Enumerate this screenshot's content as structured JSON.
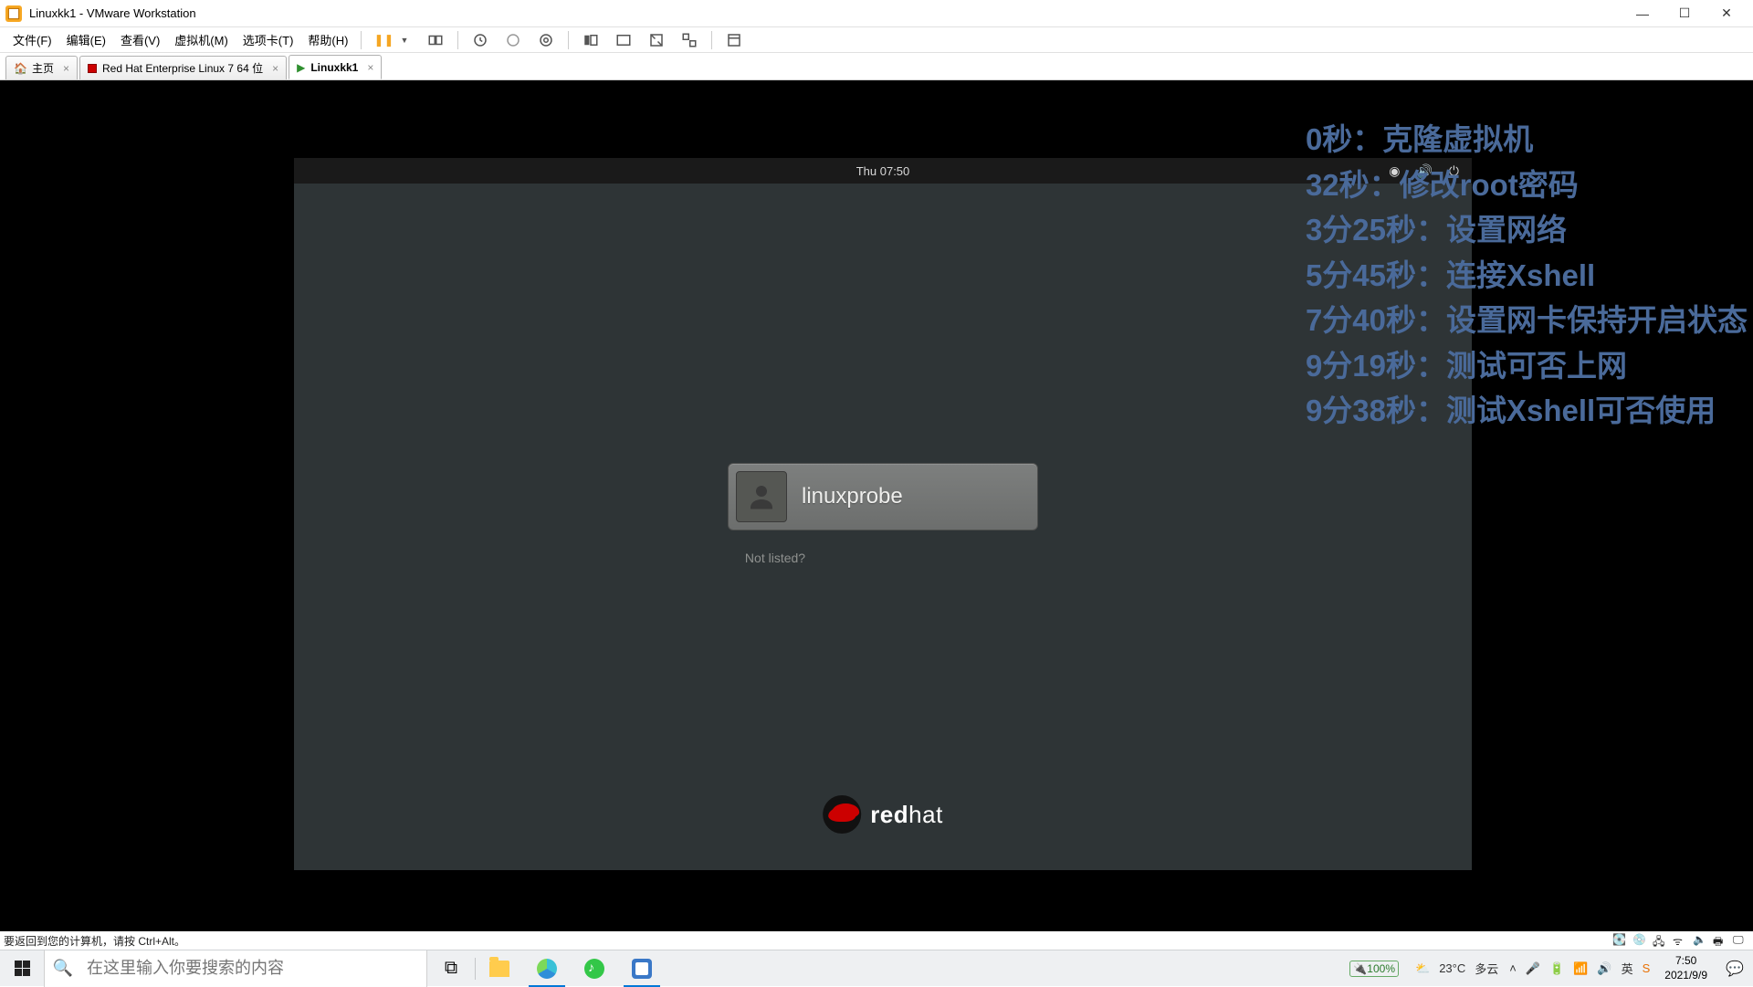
{
  "window": {
    "title": "Linuxkk1 - VMware Workstation"
  },
  "menu": {
    "file": "文件(F)",
    "edit": "编辑(E)",
    "view": "查看(V)",
    "vm": "虚拟机(M)",
    "tabs": "选项卡(T)",
    "help": "帮助(H)"
  },
  "tabs": {
    "home": "主页",
    "rhel": "Red Hat Enterprise Linux 7 64 位",
    "active": "Linuxkk1"
  },
  "gnome": {
    "clock": "Thu 07:50",
    "username": "linuxprobe",
    "not_listed": "Not listed?",
    "logo_red": "red",
    "logo_hat": "hat"
  },
  "overlay": [
    "0秒：克隆虚拟机",
    "32秒：修改root密码",
    "3分25秒：设置网络",
    "5分45秒：连接Xshell",
    "7分40秒：设置网卡保持开启状态",
    "9分19秒：测试可否上网",
    "9分38秒：测试Xshell可否使用"
  ],
  "vm_status": {
    "hint": "要返回到您的计算机，请按 Ctrl+Alt。"
  },
  "taskbar": {
    "search_placeholder": "在这里输入你要搜索的内容",
    "battery": "100%",
    "weather_temp": "23°C",
    "weather_text": "多云",
    "ime": "英",
    "time": "7:50",
    "date": "2021/9/9"
  }
}
